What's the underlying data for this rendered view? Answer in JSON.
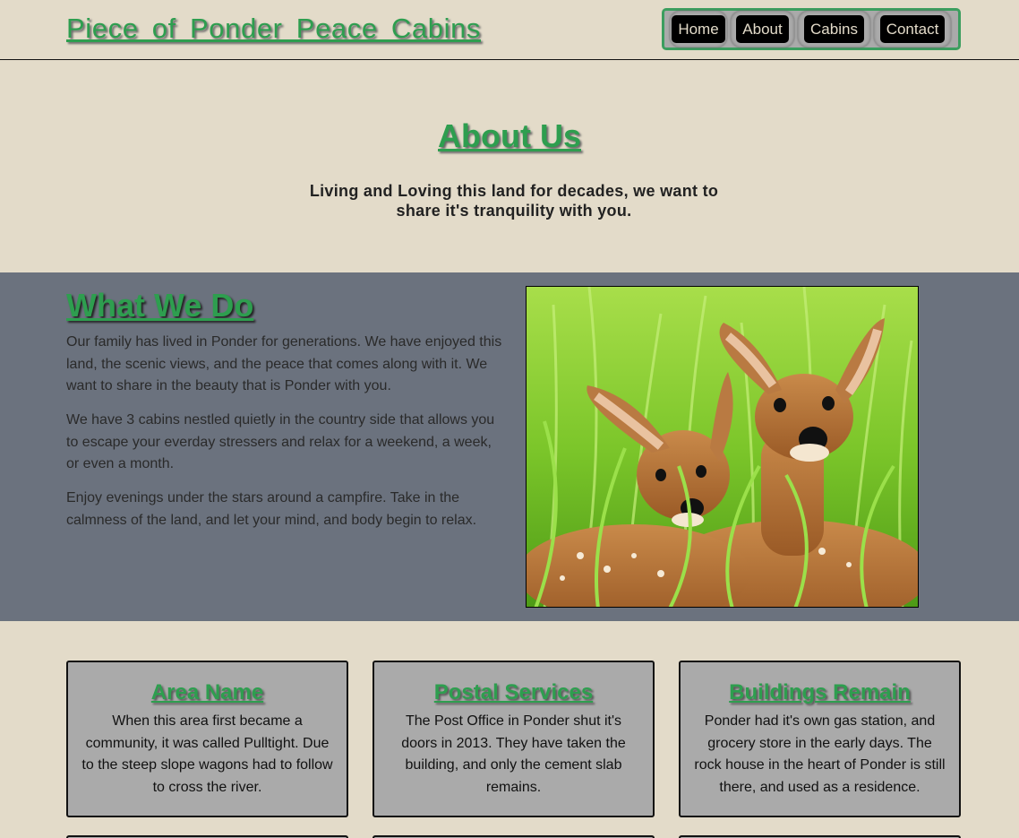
{
  "site": {
    "title": "Piece of Ponder Peace Cabins"
  },
  "nav": {
    "items": [
      {
        "label": "Home"
      },
      {
        "label": "About"
      },
      {
        "label": "Cabins"
      },
      {
        "label": "Contact"
      }
    ]
  },
  "about": {
    "title": "About Us",
    "subtitle": "Living and Loving this land for decades, we want to share it's tranquility with you."
  },
  "what_we_do": {
    "title": "What We Do",
    "paragraphs": [
      "Our family has lived in Ponder for generations. We have enjoyed this land, the scenic views, and the peace that comes along with it. We want to share in the beauty that is Ponder with you.",
      "We have 3 cabins nestled quietly in the country side that allows you to escape your everday stressers and relax for a weekend, a week, or even a month.",
      "Enjoy evenings under the stars around a campfire. Take in the calmness of the land, and let your mind, and body begin to relax."
    ]
  },
  "cards": [
    {
      "title": "Area Name",
      "text": "When this area first became a community, it was called Pulltight. Due to the steep slope wagons had to follow to cross the river."
    },
    {
      "title": "Postal Services",
      "text": "The Post Office in Ponder shut it's doors in 2013. They have taken the building, and only the cement slab remains."
    },
    {
      "title": "Buildings Remain",
      "text": "Ponder had it's own gas station, and grocery store in the early days. The rock house in the heart of Ponder is still there, and used as a residence."
    }
  ],
  "colors": {
    "background": "#e3dbc9",
    "band": "#6b727e",
    "accent_green": "#2e9e4f",
    "card": "#aaaaaa"
  }
}
